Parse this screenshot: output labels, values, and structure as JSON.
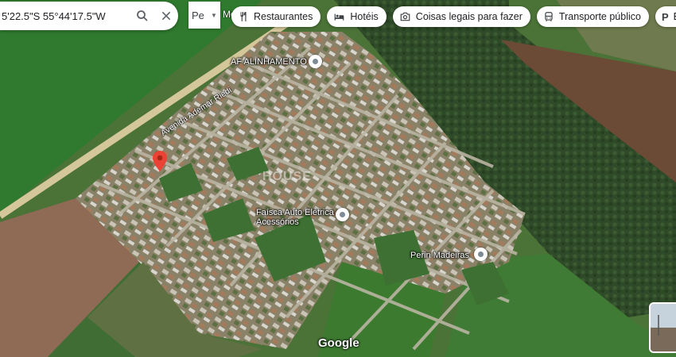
{
  "search": {
    "query": "5'22.5\"S 55°44'17.5\"W"
  },
  "layer_toggle": {
    "label": "Pe"
  },
  "partial_label": "Mo",
  "chips": [
    {
      "icon": "fork-knife-icon",
      "label": "Restaurantes"
    },
    {
      "icon": "bed-icon",
      "label": "Hotéis"
    },
    {
      "icon": "camera-icon",
      "label": "Coisas legais para fazer"
    },
    {
      "icon": "bus-icon",
      "label": "Transporte público"
    },
    {
      "icon": "parking-icon",
      "label": "E"
    }
  ],
  "pois": [
    {
      "name": "AF ALINHAMENTO"
    },
    {
      "name": "Faísca Auto Elétrica e Acessórios"
    },
    {
      "name": "Perin Madeiras"
    }
  ],
  "streets": [
    {
      "name": "Avenida Ademar Riedi"
    }
  ],
  "watermark": "HOUSE",
  "google_logo": "Google",
  "colors": {
    "pin": "#ea4335",
    "chip_bg": "#ffffff",
    "poi_icon": "#7d8b95"
  }
}
